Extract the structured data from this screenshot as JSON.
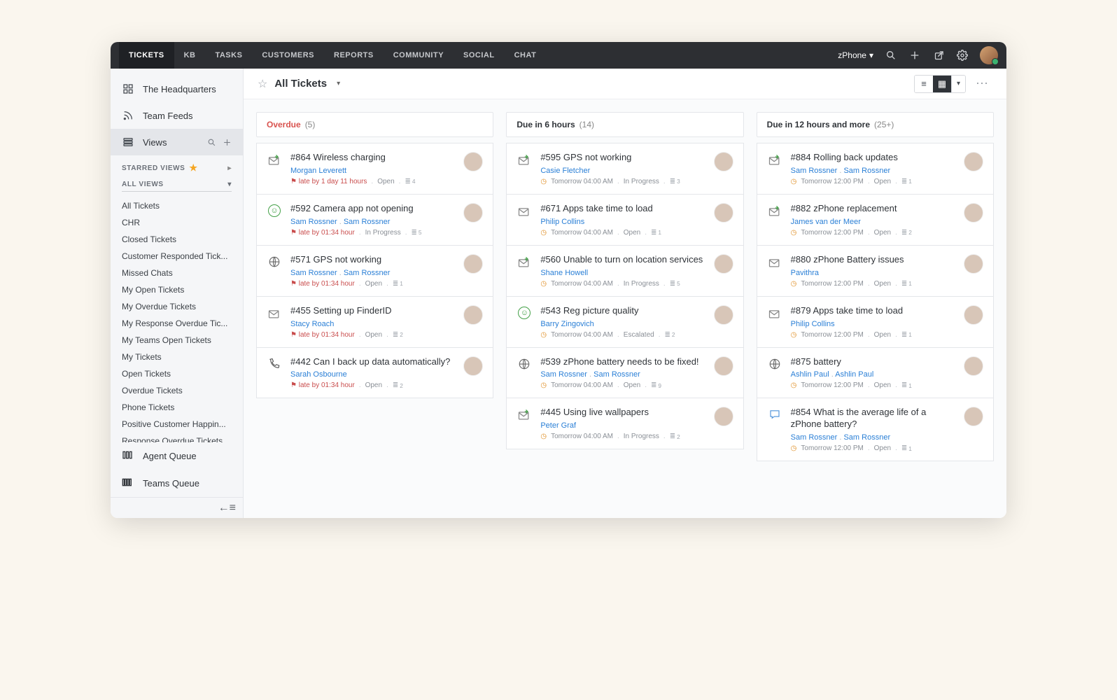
{
  "nav": {
    "tabs": [
      "TICKETS",
      "KB",
      "TASKS",
      "CUSTOMERS",
      "REPORTS",
      "COMMUNITY",
      "SOCIAL",
      "CHAT"
    ],
    "brand": "zPhone"
  },
  "sidebar": {
    "hq": "The Headquarters",
    "feeds": "Team Feeds",
    "views": "Views",
    "starred": "STARRED VIEWS",
    "allviews": "ALL VIEWS",
    "all": "All Tickets",
    "list": [
      "All Tickets",
      "CHR",
      "Closed Tickets",
      "Customer Responded Tick...",
      "Missed Chats",
      "My Open Tickets",
      "My Overdue Tickets",
      "My Response Overdue Tic...",
      "My Teams Open Tickets",
      "My Tickets",
      "Open Tickets",
      "Overdue Tickets",
      "Phone Tickets",
      "Positive Customer Happin...",
      "Response Overdue Tickets"
    ],
    "agent": "Agent Queue",
    "teams": "Teams Queue"
  },
  "header": {
    "title": "All Tickets"
  },
  "cols": [
    {
      "id": "overdue",
      "label": "Overdue",
      "count": "(5)",
      "overdue": true,
      "cards": [
        {
          "icon": "mailg",
          "title": "#864 Wireless charging",
          "who": [
            "Morgan Leverett"
          ],
          "late": "late by 1 day 11 hours",
          "status": "Open",
          "thread": "4"
        },
        {
          "icon": "happy",
          "title": "#592 Camera app not opening",
          "who": [
            "Sam Rossner",
            "Sam Rossner"
          ],
          "late": "late by 01:34 hour",
          "status": "In Progress",
          "thread": "5"
        },
        {
          "icon": "web",
          "title": "#571 GPS not working",
          "who": [
            "Sam Rossner",
            "Sam Rossner"
          ],
          "late": "late by 01:34 hour",
          "status": "Open",
          "thread": "1"
        },
        {
          "icon": "mail",
          "title": "#455 Setting up FinderID",
          "who": [
            "Stacy Roach"
          ],
          "late": "late by 01:34 hour",
          "status": "Open",
          "thread": "2"
        },
        {
          "icon": "phone",
          "title": "#442 Can I back up data automatically?",
          "who": [
            "Sarah Osbourne"
          ],
          "late": "late by 01:34 hour",
          "status": "Open",
          "thread": "2"
        }
      ]
    },
    {
      "id": "due6",
      "label": "Due in 6 hours",
      "count": "(14)",
      "cards": [
        {
          "icon": "mailg",
          "title": "#595 GPS not working",
          "who": [
            "Casie Fletcher"
          ],
          "due": "Tomorrow 04:00 AM",
          "status": "In Progress",
          "thread": "3"
        },
        {
          "icon": "mail",
          "title": "#671 Apps take time to load",
          "who": [
            "Philip Collins"
          ],
          "due": "Tomorrow 04:00 AM",
          "status": "Open",
          "thread": "1"
        },
        {
          "icon": "mailg",
          "title": "#560 Unable to turn on location services",
          "who": [
            "Shane Howell"
          ],
          "due": "Tomorrow 04:00 AM",
          "status": "In Progress",
          "thread": "5"
        },
        {
          "icon": "happyg",
          "title": "#543 Reg picture quality",
          "who": [
            "Barry Zingovich"
          ],
          "due": "Tomorrow 04:00 AM",
          "status": "Escalated",
          "thread": "2"
        },
        {
          "icon": "web",
          "title": "#539 zPhone battery needs to be fixed!",
          "who": [
            "Sam Rossner",
            "Sam Rossner"
          ],
          "due": "Tomorrow 04:00 AM",
          "status": "Open",
          "thread": "9"
        },
        {
          "icon": "mailg",
          "title": "#445 Using live wallpapers",
          "who": [
            "Peter Graf"
          ],
          "due": "Tomorrow 04:00 AM",
          "status": "In Progress",
          "thread": "2"
        }
      ]
    },
    {
      "id": "due12",
      "label": "Due in 12 hours and more",
      "count": "(25+)",
      "cards": [
        {
          "icon": "mailg",
          "title": "#884 Rolling back updates",
          "who": [
            "Sam Rossner",
            "Sam Rossner"
          ],
          "due": "Tomorrow 12:00 PM",
          "status": "Open",
          "thread": "1"
        },
        {
          "icon": "mailg",
          "title": "#882 zPhone replacement",
          "who": [
            "James van der Meer"
          ],
          "due": "Tomorrow 12:00 PM",
          "status": "Open",
          "thread": "2"
        },
        {
          "icon": "mail",
          "title": "#880 zPhone Battery issues",
          "who": [
            "Pavithra"
          ],
          "due": "Tomorrow 12:00 PM",
          "status": "Open",
          "thread": "1"
        },
        {
          "icon": "mail",
          "title": "#879 Apps take time to load",
          "who": [
            "Philip Collins"
          ],
          "due": "Tomorrow 12:00 PM",
          "status": "Open",
          "thread": "1"
        },
        {
          "icon": "web",
          "title": "#875 battery",
          "who": [
            "Ashlin Paul",
            "Ashlin Paul"
          ],
          "due": "Tomorrow 12:00 PM",
          "status": "Open",
          "thread": "1"
        },
        {
          "icon": "chat",
          "title": "#854 What is the average life of a zPhone battery?",
          "who": [
            "Sam Rossner",
            "Sam Rossner"
          ],
          "due": "Tomorrow 12:00 PM",
          "status": "Open",
          "thread": "1"
        }
      ]
    }
  ]
}
